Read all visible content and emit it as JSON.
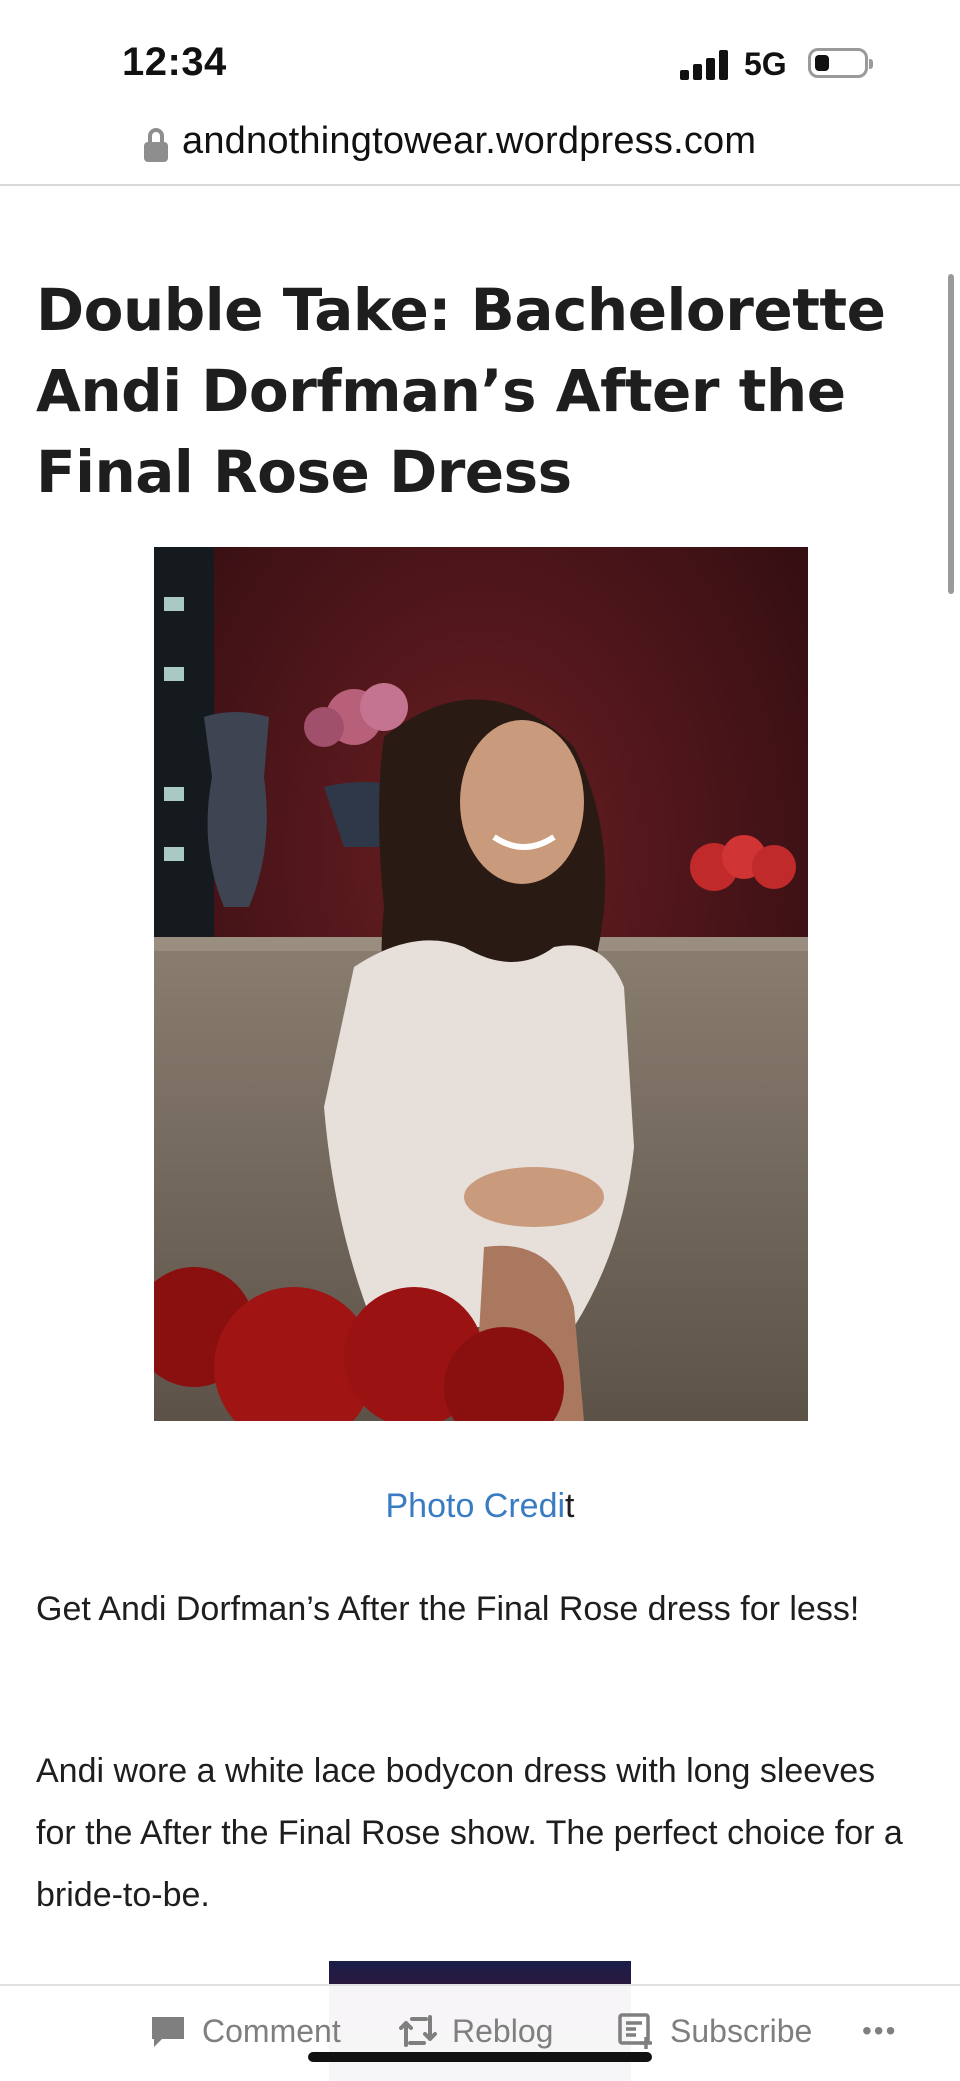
{
  "status_bar": {
    "time": "12:34",
    "network": "5G"
  },
  "address_bar": {
    "url": "andnothingtowear.wordpress.com"
  },
  "post": {
    "title": "Double Take: Bachelorette Andi Dorfman’s After the Final Rose Dress",
    "caption_link": "Photo Credi",
    "caption_tail": "t",
    "paragraphs": [
      "Get Andi Dorfman’s After the Final Rose dress for less!",
      "Andi wore a white lace bodycon dress with long sleeves for the After the Final Rose show. The perfect choice for a bride-to-be."
    ]
  },
  "action_bar": {
    "comment_label": "Comment",
    "reblog_label": "Reblog",
    "subscribe_label": "Subscribe",
    "more_label": "•••"
  },
  "colors": {
    "link": "#3a7cc4",
    "action_gray": "#7f7f7f",
    "text": "#1e1e1e"
  },
  "icons": [
    "lock-icon",
    "comment-icon",
    "reblog-icon",
    "subscribe-icon",
    "more-icon"
  ]
}
